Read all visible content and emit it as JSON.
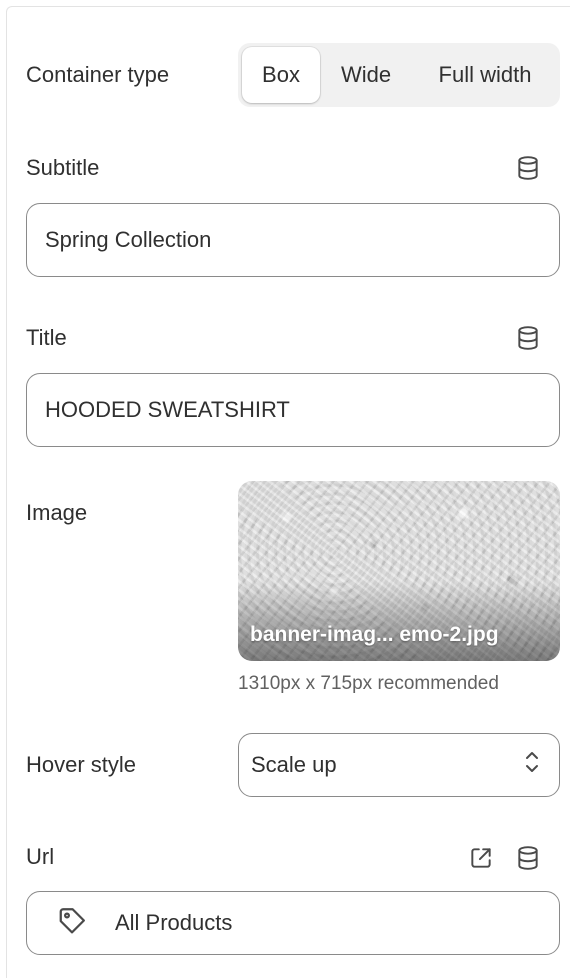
{
  "container_type": {
    "label": "Container type",
    "options": [
      "Box",
      "Wide",
      "Full width"
    ],
    "selected": "Box"
  },
  "subtitle": {
    "label": "Subtitle",
    "value": "Spring Collection",
    "icon": "database-icon"
  },
  "title": {
    "label": "Title",
    "value": "HOODED SWEATSHIRT",
    "icon": "database-icon"
  },
  "image": {
    "label": "Image",
    "filename": "banner-imag... emo-2.jpg",
    "recommendation": "1310px x 715px recommended"
  },
  "hover_style": {
    "label": "Hover style",
    "value": "Scale up",
    "icon": "chevron-up-down-icon"
  },
  "url": {
    "label": "Url",
    "value": "All Products",
    "icons": [
      "external-link-icon",
      "database-icon",
      "tag-icon"
    ]
  },
  "colors": {
    "text": "#303030",
    "border": "#8a8a8a",
    "segment_bg": "#f1f1f1",
    "hint_text": "#616161"
  }
}
